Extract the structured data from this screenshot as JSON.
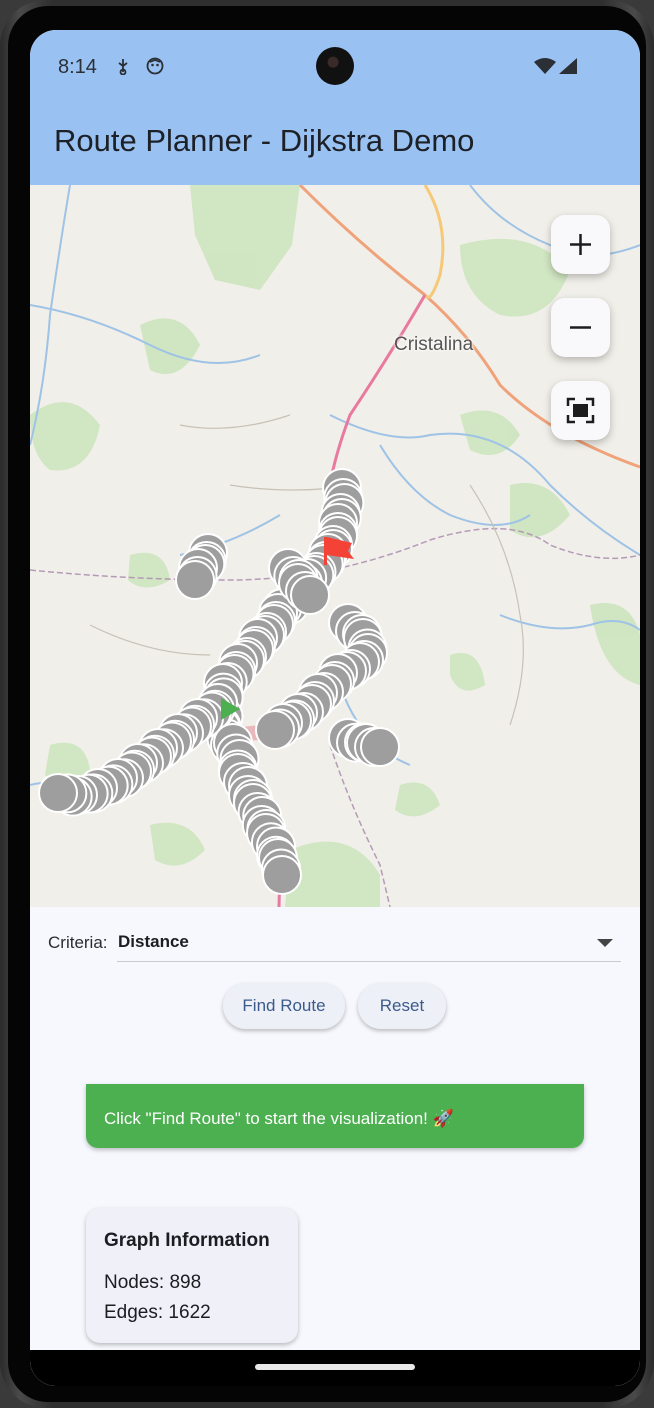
{
  "status_bar": {
    "time": "8:14",
    "left_icons": [
      "usb-debug-icon",
      "app-notification-icon"
    ],
    "right_icons": [
      "wifi-icon",
      "cellular-signal-icon"
    ]
  },
  "app_bar": {
    "title": "Route Planner - Dijkstra Demo",
    "background": "#99c2f2"
  },
  "map": {
    "place_labels": [
      "Cristalina"
    ],
    "controls": [
      {
        "name": "zoom-in",
        "icon": "plus-icon"
      },
      {
        "name": "zoom-out",
        "icon": "minus-icon"
      },
      {
        "name": "fit-bounds",
        "icon": "fit-screen-icon"
      }
    ],
    "markers": {
      "start": "play-triangle-icon",
      "end": "flag-icon",
      "start_color": "#4caf50",
      "end_color": "#f44336",
      "node_color": "#9e9e9e"
    }
  },
  "criteria": {
    "label": "Criteria:",
    "value": "Distance"
  },
  "buttons": {
    "find_route": "Find Route",
    "reset": "Reset"
  },
  "banner": {
    "text": "Click \"Find Route\" to start the visualization! 🚀",
    "color": "#4caf50"
  },
  "graph_info": {
    "title": "Graph Information",
    "nodes": "Nodes: 898",
    "edges": "Edges: 1622"
  }
}
